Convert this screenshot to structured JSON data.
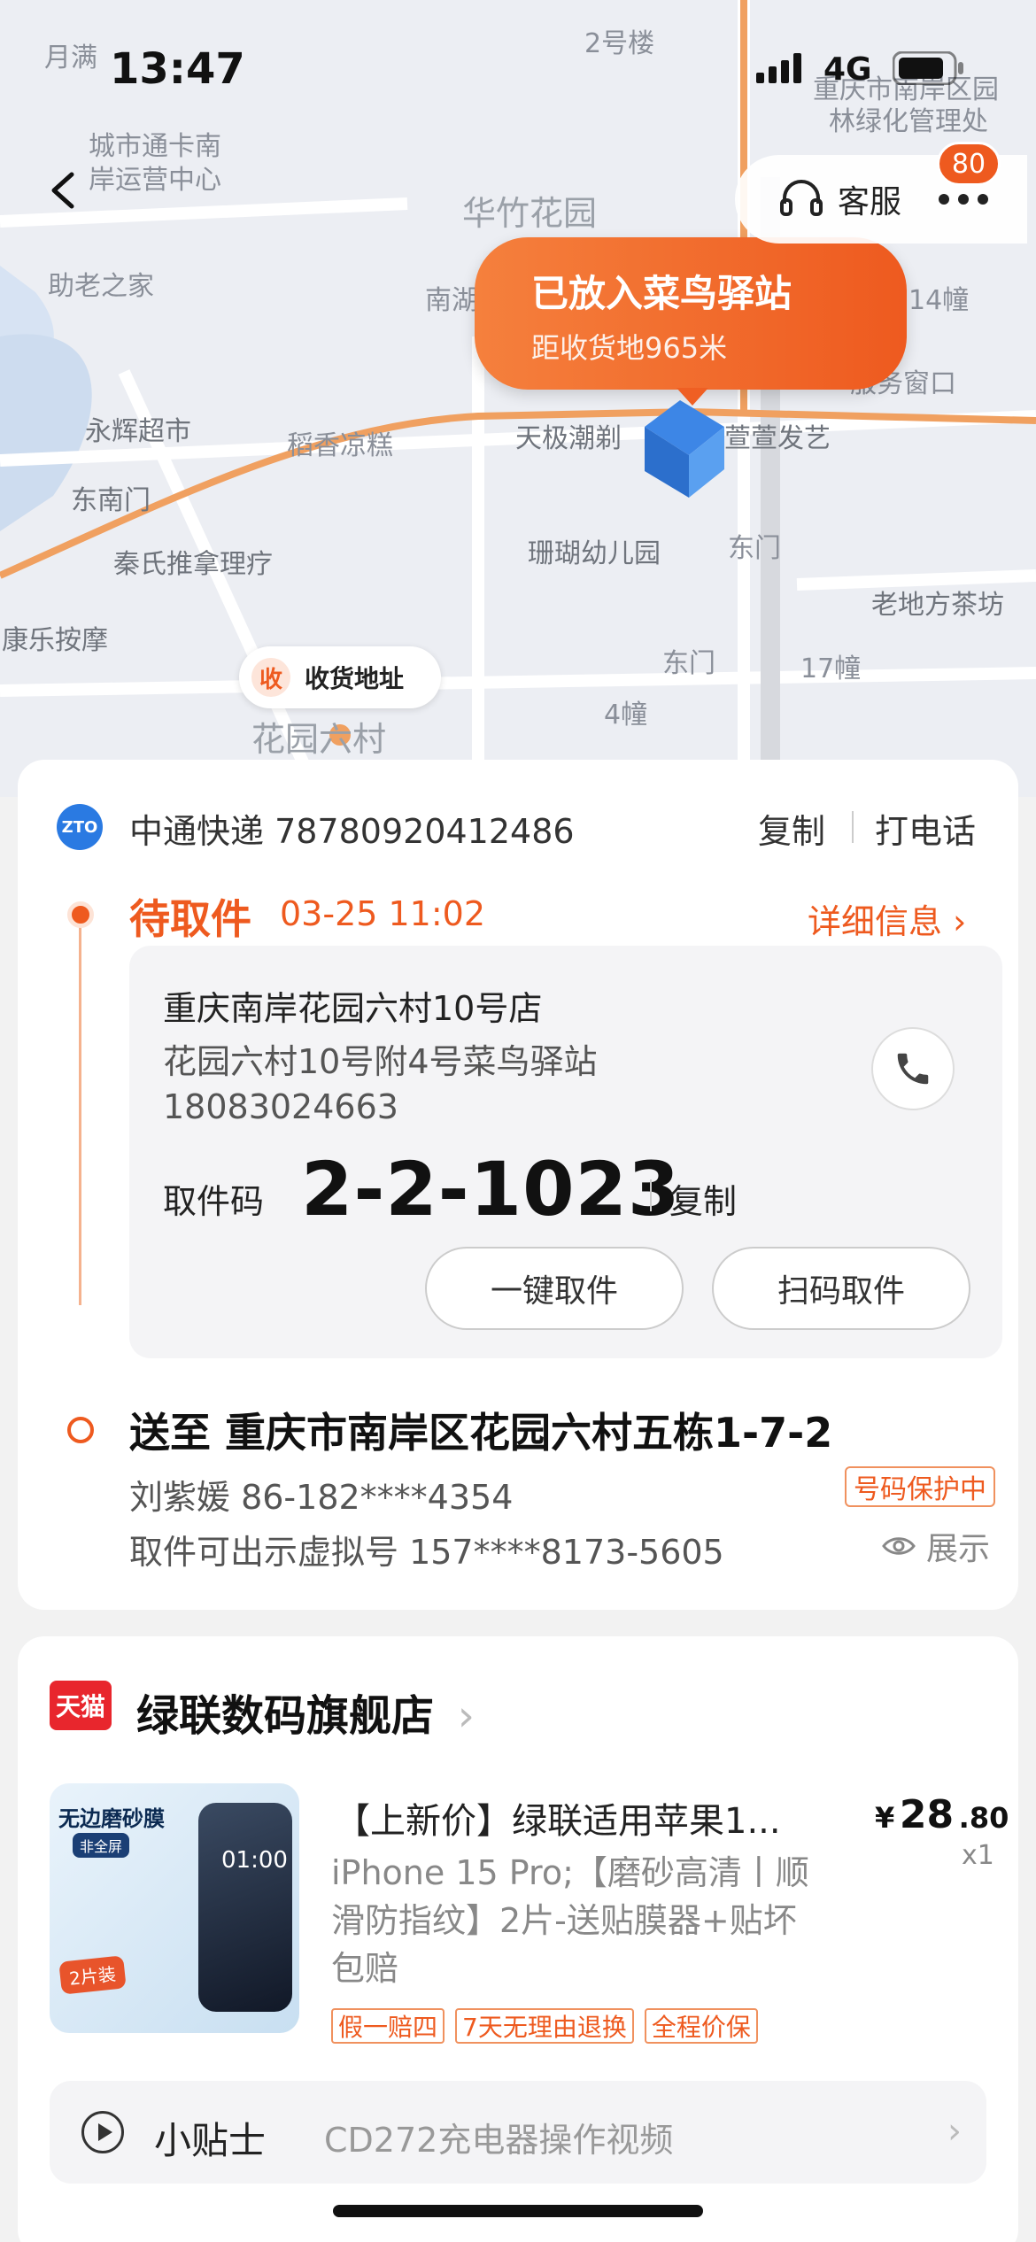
{
  "status_bar": {
    "time": "13:47",
    "network": "4G"
  },
  "map": {
    "labels": [
      {
        "text": "月满",
        "cls": ""
      },
      {
        "text": "2号楼",
        "cls": ""
      },
      {
        "text": "城市通卡南",
        "cls": ""
      },
      {
        "text": "岸运营中心",
        "cls": ""
      },
      {
        "text": "重庆市南岸区园",
        "cls": ""
      },
      {
        "text": "林绿化管理处",
        "cls": ""
      },
      {
        "text": "华竹花园",
        "cls": "big"
      },
      {
        "text": "助老之家",
        "cls": ""
      },
      {
        "text": "南湖",
        "cls": ""
      },
      {
        "text": "14幢",
        "cls": ""
      },
      {
        "text": "服务窗口",
        "cls": ""
      },
      {
        "text": "永辉超市",
        "cls": "dark"
      },
      {
        "text": "稻香凉糕",
        "cls": ""
      },
      {
        "text": "天极潮剃",
        "cls": "dark"
      },
      {
        "text": "萱萱发艺",
        "cls": "dark"
      },
      {
        "text": "东南门",
        "cls": "dark"
      },
      {
        "text": "秦氏推拿理疗",
        "cls": "dark"
      },
      {
        "text": "珊瑚幼儿园",
        "cls": "dark"
      },
      {
        "text": "东门",
        "cls": ""
      },
      {
        "text": "老地方茶坊",
        "cls": "dark"
      },
      {
        "text": "康乐按摩",
        "cls": "dark"
      },
      {
        "text": "东门",
        "cls": ""
      },
      {
        "text": "17幢",
        "cls": ""
      },
      {
        "text": "4幢",
        "cls": ""
      },
      {
        "text": "花园六村",
        "cls": "big"
      }
    ],
    "bubble_title": "已放入菜鸟驿站",
    "bubble_distance": "距收货地965米",
    "receive_chip_icon": "收",
    "receive_chip_label": "收货地址"
  },
  "header": {
    "service_label": "客服",
    "message_count": "80"
  },
  "tracking": {
    "courier_logo": "ZTO",
    "courier": "中通快递 78780920412486",
    "copy_label": "复制",
    "call_label": "打电话",
    "status": "待取件",
    "status_time": "03-25 11:02",
    "detail_label": "详细信息 ›",
    "station_name": "重庆南岸花园六村10号店",
    "station_address": "花园六村10号附4号菜鸟驿站",
    "station_phone": "18083024663",
    "pickup_code_label": "取件码",
    "pickup_code": "2-2-1023",
    "pickup_copy_label": "复制",
    "one_click_label": "一键取件",
    "scan_label": "扫码取件",
    "destination": "送至 重庆市南岸区花园六村五栋1-7-2",
    "recipient": "刘紫媛 86-182****4354",
    "protect_badge": "号码保护中",
    "virtual_number": "取件可出示虚拟号 157****8173-5605",
    "show_label": "展示"
  },
  "shop": {
    "platform_badge": "天猫",
    "name": "绿联数码旗舰店",
    "chevron": "›",
    "image_texts": {
      "headline": "无边磨砂膜",
      "sub": "非全屏",
      "clock": "01:00",
      "pack": "2片装"
    },
    "product_title": "【上新价】绿联适用苹果1...",
    "product_desc": "iPhone 15 Pro;【磨砂高清丨顺滑防指纹】2片-送贴膜器+贴坏包赔",
    "price_currency": "¥",
    "price_int": "28",
    "price_dec": ".80",
    "quantity": "x1",
    "tags": [
      "假一赔四",
      "7天无理由退换",
      "全程价保"
    ],
    "tips_title": "小贴士",
    "tips_content": "CD272充电器操作视频",
    "tips_arrow": "›"
  },
  "colors": {
    "accent": "#ee5a1f",
    "route": "#f0a060",
    "tmall": "#e8262d"
  }
}
